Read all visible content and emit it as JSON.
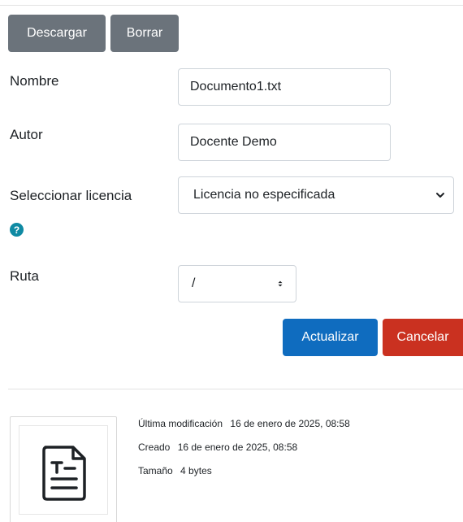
{
  "toolbar": {
    "download_label": "Descargar",
    "delete_label": "Borrar"
  },
  "form": {
    "name": {
      "label": "Nombre",
      "value": "Documento1.txt"
    },
    "author": {
      "label": "Autor",
      "value": "Docente Demo"
    },
    "license": {
      "label": "Seleccionar licencia",
      "selected": "Licencia no especificada"
    },
    "path": {
      "label": "Ruta",
      "selected": "/"
    },
    "help_glyph": "?"
  },
  "actions": {
    "update_label": "Actualizar",
    "cancel_label": "Cancelar"
  },
  "file_info": {
    "modified_label": "Última modificación",
    "modified_value": "16 de enero de 2025, 08:58",
    "created_label": "Creado",
    "created_value": "16 de enero de 2025, 08:58",
    "size_label": "Tamaño",
    "size_value": "4 bytes",
    "thumbnail_icon": "text-document-icon"
  },
  "colors": {
    "secondary": "#6b737b",
    "primary": "#0f6cbf",
    "danger": "#ca3120",
    "help": "#0f8aa3"
  }
}
